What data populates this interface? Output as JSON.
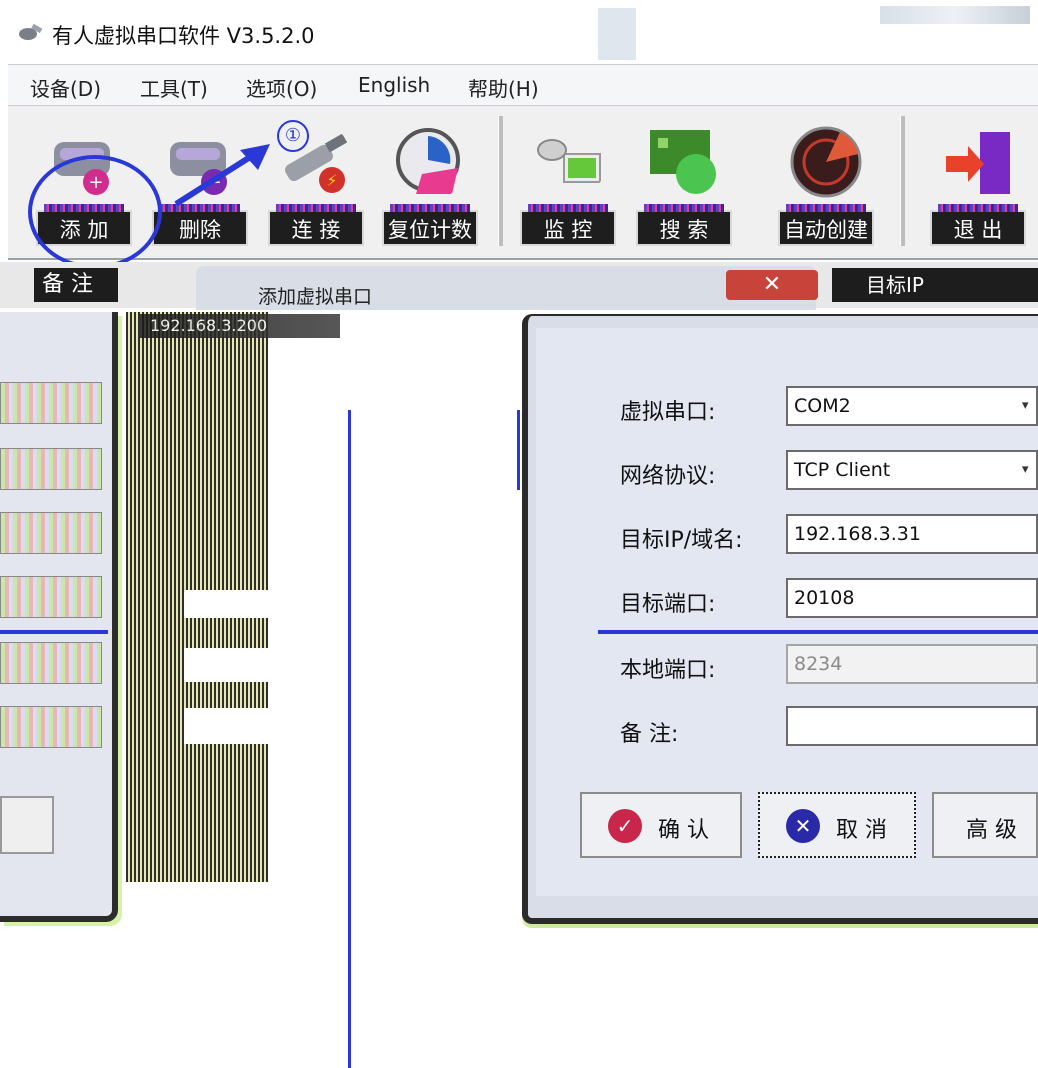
{
  "window": {
    "title": "有人虚拟串口软件 V3.5.2.0",
    "icon": "app-satellite-icon"
  },
  "menu": [
    {
      "label": "设备(D)"
    },
    {
      "label": "工具(T)"
    },
    {
      "label": "选项(O)"
    },
    {
      "label": "English"
    },
    {
      "label": "帮助(H)"
    }
  ],
  "toolbar": {
    "buttons": [
      {
        "label": "添 加",
        "icon": "serial-port-add-icon"
      },
      {
        "label": "删除",
        "icon": "serial-port-remove-icon"
      },
      {
        "label": "连 接",
        "icon": "connect-plug-icon"
      },
      {
        "label": "复位计数",
        "icon": "reset-counter-clock-icon"
      },
      {
        "label": "监 控",
        "icon": "monitor-satellite-icon"
      },
      {
        "label": "搜 索",
        "icon": "search-network-icon"
      },
      {
        "label": "自动创建",
        "icon": "radar-icon"
      },
      {
        "label": "退 出",
        "icon": "exit-door-icon"
      }
    ]
  },
  "annotation": {
    "step1": "①"
  },
  "list_header": {
    "remark": "备 注",
    "target_ip": "目标IP"
  },
  "background_row": {
    "ip": "192.168.3.200"
  },
  "dialog": {
    "title": "添加虚拟串口",
    "close": "✕",
    "fields": {
      "virtual_port": {
        "label": "虚拟串口:",
        "value": "COM2"
      },
      "protocol": {
        "label": "网络协议:",
        "value": "TCP Client"
      },
      "target_ip": {
        "label": "目标IP/域名:",
        "value": "192.168.3.31"
      },
      "target_port": {
        "label": "目标端口:",
        "value": "20108"
      },
      "local_port": {
        "label": "本地端口:",
        "value": "8234"
      },
      "remark": {
        "label": "备 注:",
        "value": ""
      }
    },
    "buttons": {
      "confirm": "确 认",
      "cancel": "取 消",
      "advanced": "高 级"
    }
  },
  "colors": {
    "annotation_blue": "#2a38d8",
    "confirm_icon": "#c8264a",
    "cancel_icon": "#2a2aa8"
  }
}
